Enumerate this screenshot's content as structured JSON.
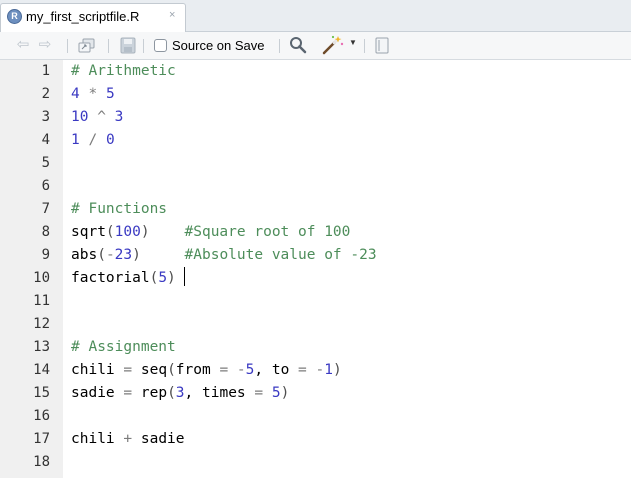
{
  "tab": {
    "title": "my_first_scriptfile.R",
    "badge": "R",
    "close": "×"
  },
  "toolbar": {
    "back_icon": "⇦",
    "forward_icon": "⇨",
    "source_on_save_label": "Source on Save",
    "source_on_save_checked": false
  },
  "editor": {
    "lines": [
      {
        "n": "1",
        "tokens": [
          {
            "t": "# Arithmetic",
            "c": "cm"
          }
        ]
      },
      {
        "n": "2",
        "tokens": [
          {
            "t": "4",
            "c": "num"
          },
          {
            "t": " * ",
            "c": "op"
          },
          {
            "t": "5",
            "c": "num"
          }
        ]
      },
      {
        "n": "3",
        "tokens": [
          {
            "t": "10",
            "c": "num"
          },
          {
            "t": " ^ ",
            "c": "op"
          },
          {
            "t": "3",
            "c": "num"
          }
        ]
      },
      {
        "n": "4",
        "tokens": [
          {
            "t": "1",
            "c": "num"
          },
          {
            "t": " / ",
            "c": "op"
          },
          {
            "t": "0",
            "c": "num"
          }
        ]
      },
      {
        "n": "5",
        "tokens": []
      },
      {
        "n": "6",
        "tokens": []
      },
      {
        "n": "7",
        "tokens": [
          {
            "t": "# Functions",
            "c": "cm"
          }
        ]
      },
      {
        "n": "8",
        "tokens": [
          {
            "t": "sqrt",
            "c": ""
          },
          {
            "t": "(",
            "c": "par"
          },
          {
            "t": "100",
            "c": "num"
          },
          {
            "t": ")",
            "c": "par"
          },
          {
            "t": "    ",
            "c": ""
          },
          {
            "t": "#Square root of 100",
            "c": "cm"
          }
        ]
      },
      {
        "n": "9",
        "tokens": [
          {
            "t": "abs",
            "c": ""
          },
          {
            "t": "(",
            "c": "par"
          },
          {
            "t": "-",
            "c": "op"
          },
          {
            "t": "23",
            "c": "num"
          },
          {
            "t": ")",
            "c": "par"
          },
          {
            "t": "     ",
            "c": ""
          },
          {
            "t": "#Absolute value of -23",
            "c": "cm"
          }
        ]
      },
      {
        "n": "10",
        "tokens": [
          {
            "t": "factorial",
            "c": ""
          },
          {
            "t": "(",
            "c": "par"
          },
          {
            "t": "5",
            "c": "num"
          },
          {
            "t": ")",
            "c": "par"
          }
        ],
        "cursor": true
      },
      {
        "n": "11",
        "tokens": []
      },
      {
        "n": "12",
        "tokens": []
      },
      {
        "n": "13",
        "tokens": [
          {
            "t": "# Assignment",
            "c": "cm"
          }
        ]
      },
      {
        "n": "14",
        "tokens": [
          {
            "t": "chili",
            "c": ""
          },
          {
            "t": " = ",
            "c": "op"
          },
          {
            "t": "seq",
            "c": ""
          },
          {
            "t": "(",
            "c": "par"
          },
          {
            "t": "from",
            "c": ""
          },
          {
            "t": " = ",
            "c": "op"
          },
          {
            "t": "-",
            "c": "op"
          },
          {
            "t": "5",
            "c": "num"
          },
          {
            "t": ", ",
            "c": ""
          },
          {
            "t": "to",
            "c": ""
          },
          {
            "t": " = ",
            "c": "op"
          },
          {
            "t": "-",
            "c": "op"
          },
          {
            "t": "1",
            "c": "num"
          },
          {
            "t": ")",
            "c": "par"
          }
        ]
      },
      {
        "n": "15",
        "tokens": [
          {
            "t": "sadie",
            "c": ""
          },
          {
            "t": " = ",
            "c": "op"
          },
          {
            "t": "rep",
            "c": ""
          },
          {
            "t": "(",
            "c": "par"
          },
          {
            "t": "3",
            "c": "num"
          },
          {
            "t": ", ",
            "c": ""
          },
          {
            "t": "times",
            "c": ""
          },
          {
            "t": " = ",
            "c": "op"
          },
          {
            "t": "5",
            "c": "num"
          },
          {
            "t": ")",
            "c": "par"
          }
        ]
      },
      {
        "n": "16",
        "tokens": []
      },
      {
        "n": "17",
        "tokens": [
          {
            "t": "chili",
            "c": ""
          },
          {
            "t": " + ",
            "c": "op"
          },
          {
            "t": "sadie",
            "c": ""
          }
        ]
      },
      {
        "n": "18",
        "tokens": []
      }
    ]
  },
  "colors": {
    "comment": "#4d8d5a",
    "number": "#3a39c2",
    "operator": "#7c7c7c",
    "gutter_bg": "#f0f0f0"
  }
}
